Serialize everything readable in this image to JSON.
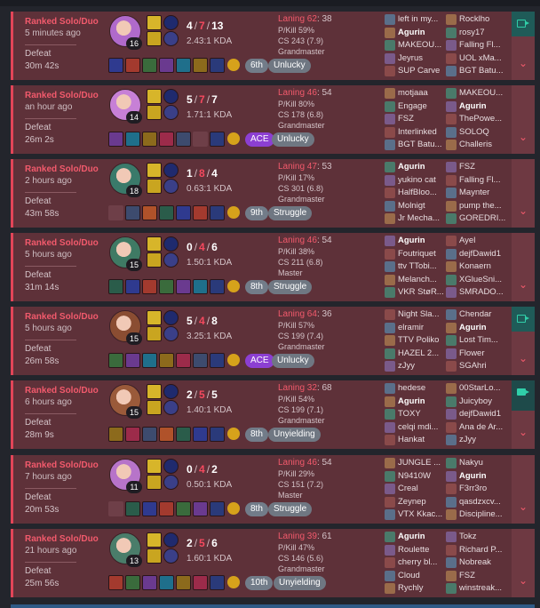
{
  "matches": [
    {
      "queue": "Ranked Solo/Duo",
      "time": "5 minutes ago",
      "result": "Defeat",
      "duration": "30m 42s",
      "champion_level": "16",
      "kills": "4",
      "deaths": "7",
      "assists": "13",
      "kda": "2.43:1 KDA",
      "laning_label": "Laning 62",
      "laning_value": ": 38",
      "kill_participation": "P/Kill 59%",
      "cs": "CS 243 (7.9)",
      "rank": "Grandmaster",
      "placement": "6th",
      "tag": "Unlucky",
      "placement_style": "plain",
      "team_blue": [
        "left in my...",
        "Agurin",
        "MAKEOU...",
        "Jeyrus",
        "SUP Carve"
      ],
      "team_red": [
        "Rocklho",
        "rosy17",
        "Falling Fl...",
        "UOL xMa...",
        "BGT Batu..."
      ],
      "video": "outline"
    },
    {
      "queue": "Ranked Solo/Duo",
      "time": "an hour ago",
      "result": "Defeat",
      "duration": "26m 2s",
      "champion_level": "14",
      "kills": "5",
      "deaths": "7",
      "assists": "7",
      "kda": "1.71:1 KDA",
      "laning_label": "Laning 46",
      "laning_value": ": 54",
      "kill_participation": "P/Kill 80%",
      "cs": "CS 178 (6.8)",
      "rank": "Grandmaster",
      "placement": "ACE",
      "tag": "Unlucky",
      "placement_style": "ace",
      "team_blue": [
        "motjaaa",
        "Engage",
        "FSZ",
        "Interlinked",
        "BGT Batu..."
      ],
      "team_red": [
        "MAKEOU...",
        "Agurin",
        "ThePowe...",
        "SOLOQ",
        "Challeris"
      ],
      "video": "none"
    },
    {
      "queue": "Ranked Solo/Duo",
      "time": "2 hours ago",
      "result": "Defeat",
      "duration": "43m 58s",
      "champion_level": "18",
      "kills": "1",
      "deaths": "8",
      "assists": "4",
      "kda": "0.63:1 KDA",
      "laning_label": "Laning 47",
      "laning_value": ": 53",
      "kill_participation": "P/Kill 17%",
      "cs": "CS 301 (6.8)",
      "rank": "Grandmaster",
      "placement": "9th",
      "tag": "Struggle",
      "placement_style": "plain",
      "team_blue": [
        "Agurin",
        "yukino cat",
        "HalfBloo...",
        "Molnigt",
        "Jr Mecha..."
      ],
      "team_red": [
        "FSZ",
        "Falling Fl...",
        "Maynter",
        "pump the...",
        "GOREDRI..."
      ],
      "video": "none"
    },
    {
      "queue": "Ranked Solo/Duo",
      "time": "5 hours ago",
      "result": "Defeat",
      "duration": "31m 14s",
      "champion_level": "15",
      "kills": "0",
      "deaths": "4",
      "assists": "6",
      "kda": "1.50:1 KDA",
      "laning_label": "Laning 46",
      "laning_value": ": 54",
      "kill_participation": "P/Kill 38%",
      "cs": "CS 211 (6.8)",
      "rank": "Master",
      "placement": "8th",
      "tag": "Struggle",
      "placement_style": "plain",
      "team_blue": [
        "Agurin",
        "Foutriquet",
        "ttv TTobi...",
        "Melanch...",
        "VKR StøR..."
      ],
      "team_red": [
        "Ayel",
        "dejfDawid1",
        "Konaern",
        "XGlueSni...",
        "SMRADO..."
      ],
      "video": "none"
    },
    {
      "queue": "Ranked Solo/Duo",
      "time": "5 hours ago",
      "result": "Defeat",
      "duration": "26m 58s",
      "champion_level": "15",
      "kills": "5",
      "deaths": "4",
      "assists": "8",
      "kda": "3.25:1 KDA",
      "laning_label": "Laning 64",
      "laning_value": ": 36",
      "kill_participation": "P/Kill 57%",
      "cs": "CS 199 (7.4)",
      "rank": "Grandmaster",
      "placement": "ACE",
      "tag": "Unlucky",
      "placement_style": "ace",
      "team_blue": [
        "Night Sla...",
        "elramir",
        "TTV Poliko",
        "HAZEL 2...",
        "zJyy"
      ],
      "team_red": [
        "Chendar",
        "Agurin",
        "Lost Tim...",
        "Flower",
        "SGAhri"
      ],
      "video": "outline"
    },
    {
      "queue": "Ranked Solo/Duo",
      "time": "6 hours ago",
      "result": "Defeat",
      "duration": "28m 9s",
      "champion_level": "15",
      "kills": "2",
      "deaths": "5",
      "assists": "5",
      "kda": "1.40:1 KDA",
      "laning_label": "Laning 32",
      "laning_value": ": 68",
      "kill_participation": "P/Kill 54%",
      "cs": "CS 199 (7.1)",
      "rank": "Grandmaster",
      "placement": "8th",
      "tag": "Unyielding",
      "placement_style": "plain",
      "team_blue": [
        "hedese",
        "Agurin",
        "TOXY",
        "celqi mdi...",
        "Hankat"
      ],
      "team_red": [
        "00StarLo...",
        "Juicyboy",
        "dejfDawid1",
        "Ana de Ar...",
        "zJyy"
      ],
      "video": "full"
    },
    {
      "queue": "Ranked Solo/Duo",
      "time": "7 hours ago",
      "result": "Defeat",
      "duration": "20m 53s",
      "champion_level": "11",
      "kills": "0",
      "deaths": "4",
      "assists": "2",
      "kda": "0.50:1 KDA",
      "laning_label": "Laning 46",
      "laning_value": ": 54",
      "kill_participation": "P/Kill 29%",
      "cs": "CS 151 (7.2)",
      "rank": "Master",
      "placement": "8th",
      "tag": "Struggle",
      "placement_style": "plain",
      "team_blue": [
        "JUNGLE ...",
        "N9410W",
        "Creal",
        "Zeynep",
        "VTX Kkac..."
      ],
      "team_red": [
        "Nakyu",
        "Agurin",
        "F3rr3ro",
        "qasdzxcv...",
        "Discipline..."
      ],
      "video": "none"
    },
    {
      "queue": "Ranked Solo/Duo",
      "time": "21 hours ago",
      "result": "Defeat",
      "duration": "25m 56s",
      "champion_level": "13",
      "kills": "2",
      "deaths": "5",
      "assists": "6",
      "kda": "1.60:1 KDA",
      "laning_label": "Laning 39",
      "laning_value": ": 61",
      "kill_participation": "P/Kill 47%",
      "cs": "CS 146 (5.6)",
      "rank": "Grandmaster",
      "placement": "10th",
      "tag": "Unyielding",
      "placement_style": "plain",
      "team_blue": [
        "Agurin",
        "Roulette",
        "cherry bl...",
        "Cloud",
        "Rychly"
      ],
      "team_red": [
        "Tokz",
        "Richard P...",
        "Nobreak",
        "FSZ",
        "winstreak..."
      ],
      "video": "none"
    }
  ],
  "highlight_player": "Agurin",
  "colors": {
    "defeat_bg": "#5e3139",
    "defeat_accent": "#e24558",
    "ace": "#8c3fd2",
    "video": "#30cfa9"
  }
}
